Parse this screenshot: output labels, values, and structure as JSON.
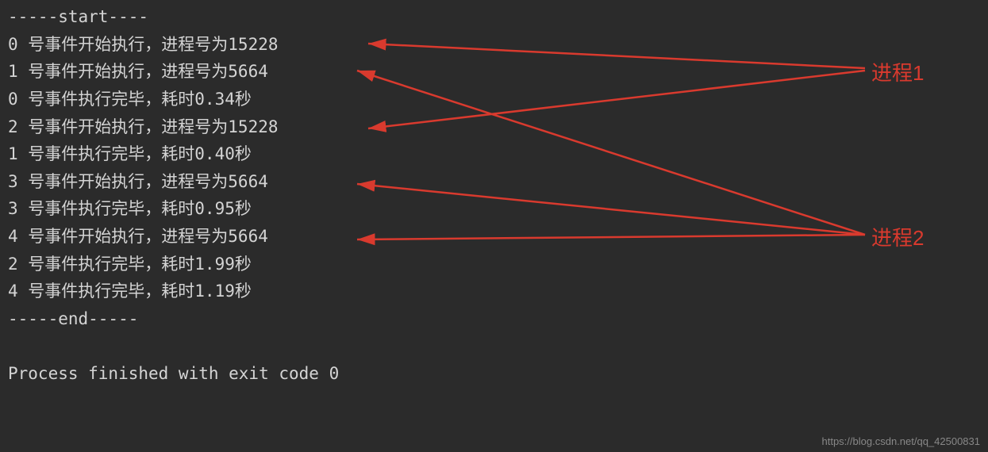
{
  "terminal": {
    "lines": [
      "-----start----",
      "0 号事件开始执行，进程号为15228",
      "1 号事件开始执行，进程号为5664",
      "0 号事件执行完毕，耗时0.34秒",
      "2 号事件开始执行，进程号为15228",
      "1 号事件执行完毕，耗时0.40秒",
      "3 号事件开始执行，进程号为5664",
      "3 号事件执行完毕，耗时0.95秒",
      "4 号事件开始执行，进程号为5664",
      "2 号事件执行完毕，耗时1.99秒",
      "4 号事件执行完毕，耗时1.19秒",
      "-----end-----"
    ],
    "exit_message": "Process finished with exit code 0"
  },
  "annotations": {
    "label1": "进程1",
    "label2": "进程2"
  },
  "watermark": "https://blog.csdn.net/qq_42500831"
}
